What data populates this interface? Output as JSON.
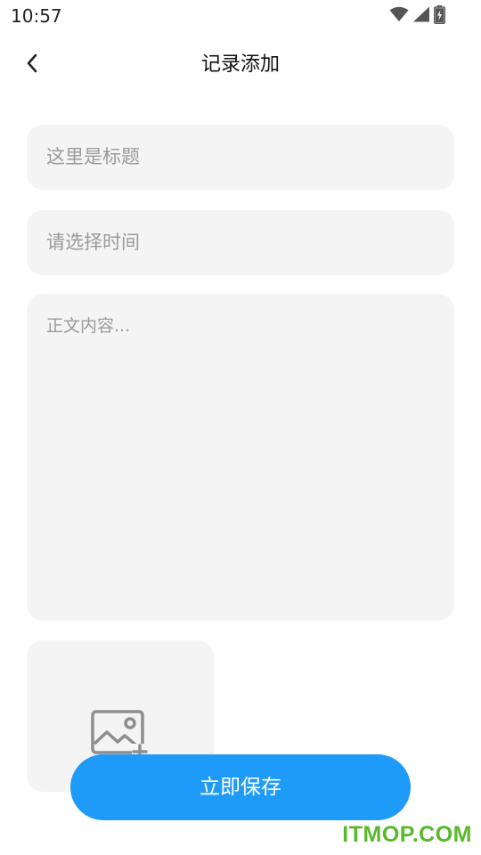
{
  "status_bar": {
    "time": "10:57",
    "icons": [
      "wifi-icon",
      "signal-icon",
      "battery-charging-icon"
    ]
  },
  "header": {
    "title": "记录添加",
    "back_icon": "chevron-left-icon"
  },
  "form": {
    "title_placeholder": "这里是标题",
    "time_placeholder": "请选择时间",
    "body_placeholder": "正文内容..."
  },
  "image_picker": {
    "icon": "add-image-icon"
  },
  "actions": {
    "save_label": "立即保存"
  },
  "watermark": {
    "text": "ITMOP.COM"
  },
  "colors": {
    "accent": "#1e9bf8",
    "field_bg": "#f4f4f4",
    "placeholder": "#9a9a9a",
    "watermark": "#58b92b"
  }
}
